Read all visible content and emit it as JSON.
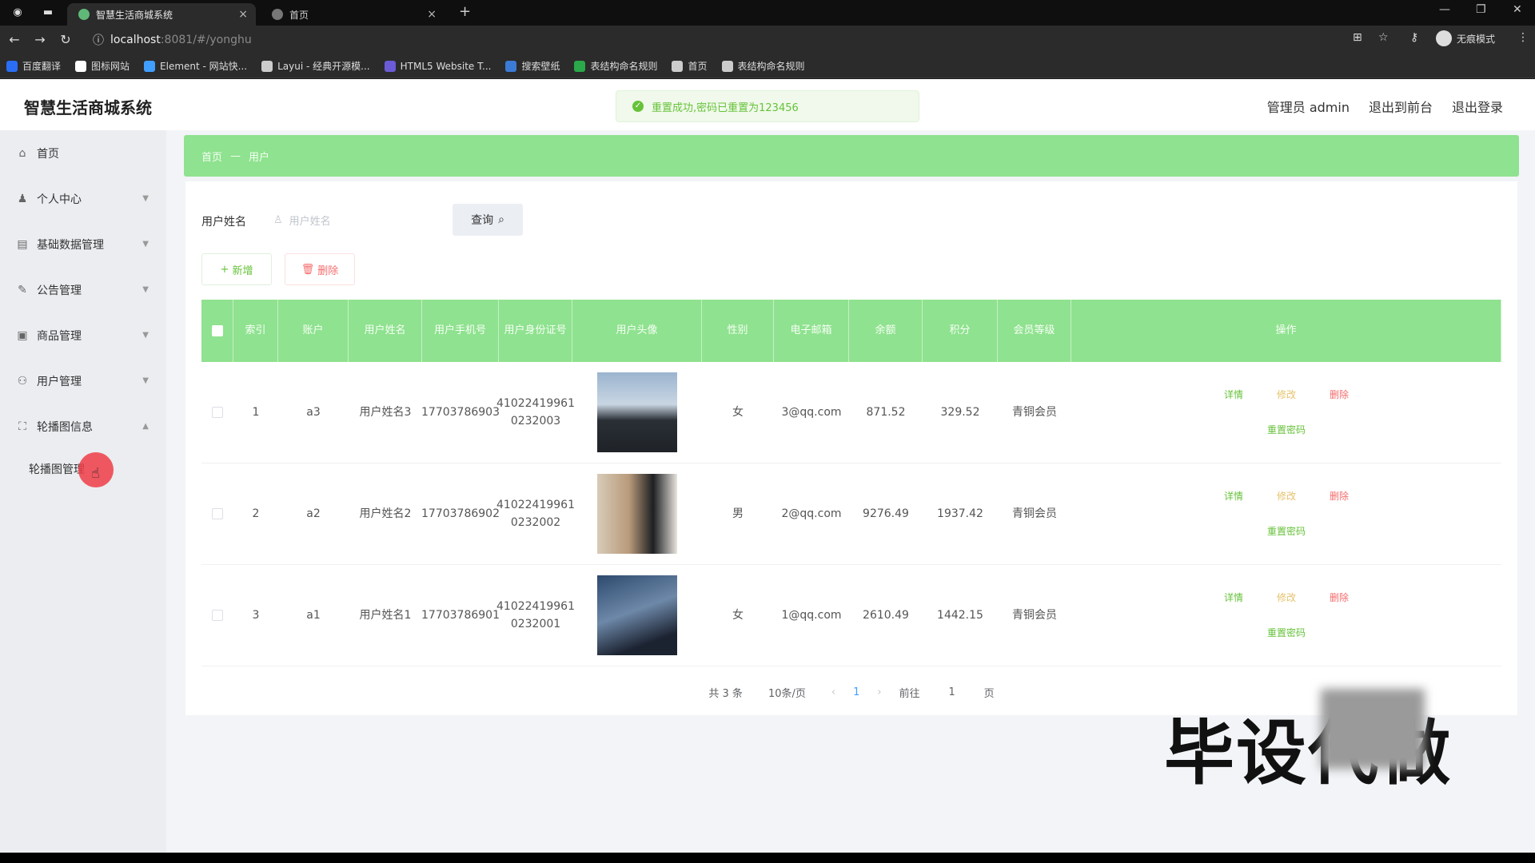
{
  "browser": {
    "tabs": [
      {
        "title": "智慧生活商城系统",
        "active": true
      },
      {
        "title": "首页",
        "active": false
      }
    ],
    "url_host": "localhost",
    "url_path": ":8081/#/yonghu",
    "incognito_label": "无痕模式",
    "bookmarks": [
      {
        "label": "百度翻译",
        "color": "#2a6ef5"
      },
      {
        "label": "图标网站",
        "color": "#ffffff"
      },
      {
        "label": "Element - 网站快...",
        "color": "#409eff"
      },
      {
        "label": "Layui - 经典开源模...",
        "color": "#cccccc"
      },
      {
        "label": "HTML5 Website T...",
        "color": "#6b5bd6"
      },
      {
        "label": "搜索壁纸",
        "color": "#3b7bd6"
      },
      {
        "label": "表结构命名规则",
        "color": "#2aa84a"
      },
      {
        "label": "首页",
        "color": "#cccccc"
      },
      {
        "label": "表结构命名规则",
        "color": "#cccccc"
      }
    ]
  },
  "header": {
    "title": "智慧生活商城系统",
    "admin": "管理员 admin",
    "to_front": "退出到前台",
    "logout": "退出登录"
  },
  "toast": {
    "message": "重置成功,密码已重置为123456"
  },
  "sidebar": {
    "items": [
      {
        "label": "首页",
        "icon": "home-icon",
        "glyph": "⌂"
      },
      {
        "label": "个人中心",
        "icon": "user-icon",
        "glyph": "♟"
      },
      {
        "label": "基础数据管理",
        "icon": "document-icon",
        "glyph": "▤"
      },
      {
        "label": "公告管理",
        "icon": "notice-icon",
        "glyph": "✎"
      },
      {
        "label": "商品管理",
        "icon": "goods-icon",
        "glyph": "▣"
      },
      {
        "label": "用户管理",
        "icon": "users-icon",
        "glyph": "⚇"
      },
      {
        "label": "轮播图信息",
        "icon": "carousel-icon",
        "glyph": "⛶"
      }
    ],
    "submenu": {
      "label": "轮播图管理"
    }
  },
  "breadcrumb": {
    "home": "首页",
    "sep": "—",
    "current": "用户"
  },
  "search": {
    "label": "用户姓名",
    "placeholder": "用户姓名",
    "button": "查询"
  },
  "actions": {
    "add": "新增",
    "delete": "删除"
  },
  "table": {
    "columns": [
      "索引",
      "账户",
      "用户姓名",
      "用户手机号",
      "用户身份证号",
      "用户头像",
      "性别",
      "电子邮箱",
      "余额",
      "积分",
      "会员等级",
      "操作"
    ],
    "rows": [
      {
        "index": "1",
        "account": "a3",
        "name": "用户姓名3",
        "phone": "17703786903",
        "id_line1": "41022419961",
        "id_line2": "0232003",
        "gender": "女",
        "email": "3@qq.com",
        "balance": "871.52",
        "points": "329.52",
        "level": "青铜会员"
      },
      {
        "index": "2",
        "account": "a2",
        "name": "用户姓名2",
        "phone": "17703786902",
        "id_line1": "41022419961",
        "id_line2": "0232002",
        "gender": "男",
        "email": "2@qq.com",
        "balance": "9276.49",
        "points": "1937.42",
        "level": "青铜会员"
      },
      {
        "index": "3",
        "account": "a1",
        "name": "用户姓名1",
        "phone": "17703786901",
        "id_line1": "41022419961",
        "id_line2": "0232001",
        "gender": "女",
        "email": "1@qq.com",
        "balance": "2610.49",
        "points": "1442.15",
        "level": "青铜会员"
      }
    ],
    "op_labels": {
      "detail": "详情",
      "edit": "修改",
      "delete": "删除",
      "reset": "重置密码"
    }
  },
  "pager": {
    "total": "共 3 条",
    "page_size": "10条/页",
    "current": "1",
    "goto_prefix": "前往",
    "goto_value": "1",
    "goto_suffix": "页"
  },
  "watermark": {
    "text": "毕设代做"
  }
}
